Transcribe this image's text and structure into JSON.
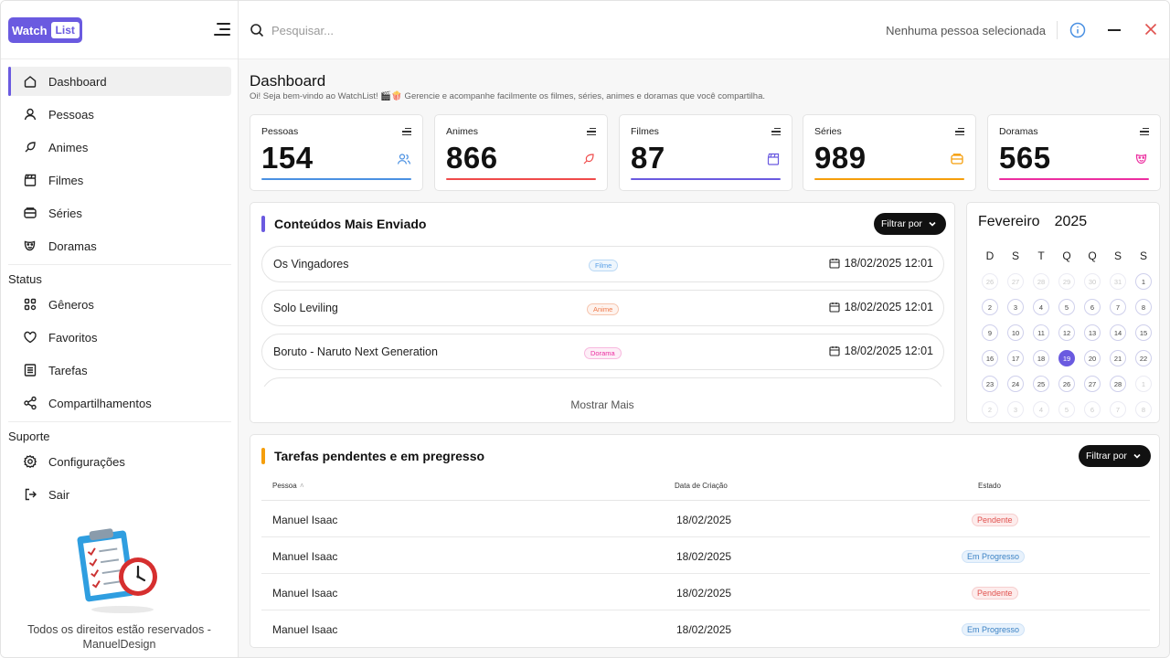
{
  "app": {
    "logo_word": "Watch",
    "logo_badge": "List"
  },
  "sidebar": {
    "items": [
      {
        "label": "Dashboard",
        "icon": "home-icon"
      },
      {
        "label": "Pessoas",
        "icon": "person-icon"
      },
      {
        "label": "Animes",
        "icon": "leaf-icon"
      },
      {
        "label": "Filmes",
        "icon": "clapper-icon"
      },
      {
        "label": "Séries",
        "icon": "tv-icon"
      },
      {
        "label": "Doramas",
        "icon": "mask-icon"
      }
    ],
    "status_title": "Status",
    "status_items": [
      {
        "label": "Gêneros",
        "icon": "grid-icon"
      },
      {
        "label": "Favoritos",
        "icon": "heart-icon"
      },
      {
        "label": "Tarefas",
        "icon": "list-icon"
      },
      {
        "label": "Compartilhamentos",
        "icon": "share-icon"
      }
    ],
    "support_title": "Suporte",
    "support_items": [
      {
        "label": "Configurações",
        "icon": "gear-icon"
      },
      {
        "label": "Sair",
        "icon": "logout-icon"
      }
    ],
    "footer": "Todos os direitos estão reservados  -  ManuelDesign"
  },
  "topbar": {
    "search_placeholder": "Pesquisar...",
    "person_status": "Nenhuma pessoa selecionada"
  },
  "page": {
    "title": "Dashboard",
    "subtitle": "Oi! Seja bem-vindo ao WatchList! 🎬🍿 Gerencie e acompanhe facilmente os filmes, séries, animes e doramas que você compartilha."
  },
  "stats": [
    {
      "label": "Pessoas",
      "value": "154",
      "color": "#4a90e2",
      "icon": "people-icon"
    },
    {
      "label": "Animes",
      "value": "866",
      "color": "#ef4b4b",
      "icon": "leaf-icon"
    },
    {
      "label": "Filmes",
      "value": "87",
      "color": "#6a5ae0",
      "icon": "clapper-icon"
    },
    {
      "label": "Séries",
      "value": "989",
      "color": "#f59e0b",
      "icon": "tv-icon"
    },
    {
      "label": "Doramas",
      "value": "565",
      "color": "#ec2ea0",
      "icon": "mask-icon"
    }
  ],
  "content_panel": {
    "title": "Conteúdos Mais Enviado",
    "accent": "#6a5ae0",
    "filter_label": "Filtrar por",
    "show_more": "Mostrar Mais",
    "rows": [
      {
        "name": "Os Vingadores",
        "tag": "Filme",
        "tag_color": "#5aa0e6",
        "date": "18/02/2025 12:01"
      },
      {
        "name": "Solo Leviling",
        "tag": "Anime",
        "tag_color": "#ef7a4b",
        "date": "18/02/2025 12:01"
      },
      {
        "name": "Boruto - Naruto Next Generation",
        "tag": "Dorama",
        "tag_color": "#ec2ea0",
        "date": "18/02/2025 12:01"
      }
    ]
  },
  "calendar": {
    "month": "Fevereiro",
    "year": "2025",
    "weekdays": [
      "D",
      "S",
      "T",
      "Q",
      "Q",
      "S",
      "S"
    ],
    "selected_day": "19",
    "weeks": [
      [
        [
          "26",
          1
        ],
        [
          "27",
          1
        ],
        [
          "28",
          1
        ],
        [
          "29",
          1
        ],
        [
          "30",
          1
        ],
        [
          "31",
          1
        ],
        [
          "1",
          0
        ]
      ],
      [
        [
          "2",
          0
        ],
        [
          "3",
          0
        ],
        [
          "4",
          0
        ],
        [
          "5",
          0
        ],
        [
          "6",
          0
        ],
        [
          "7",
          0
        ],
        [
          "8",
          0
        ]
      ],
      [
        [
          "9",
          0
        ],
        [
          "10",
          0
        ],
        [
          "11",
          0
        ],
        [
          "12",
          0
        ],
        [
          "13",
          0
        ],
        [
          "14",
          0
        ],
        [
          "15",
          0
        ]
      ],
      [
        [
          "16",
          0
        ],
        [
          "17",
          0
        ],
        [
          "18",
          0
        ],
        [
          "19",
          0
        ],
        [
          "20",
          0
        ],
        [
          "21",
          0
        ],
        [
          "22",
          0
        ]
      ],
      [
        [
          "23",
          0
        ],
        [
          "24",
          0
        ],
        [
          "25",
          0
        ],
        [
          "26",
          0
        ],
        [
          "27",
          0
        ],
        [
          "28",
          0
        ],
        [
          "1",
          1
        ]
      ],
      [
        [
          "2",
          1
        ],
        [
          "3",
          1
        ],
        [
          "4",
          1
        ],
        [
          "5",
          1
        ],
        [
          "6",
          1
        ],
        [
          "7",
          1
        ],
        [
          "8",
          1
        ]
      ]
    ]
  },
  "tasks_panel": {
    "title": "Tarefas pendentes e em pregresso",
    "accent": "#f59e0b",
    "filter_label": "Filtrar por",
    "columns": [
      "Pessoa",
      "Data de Criação",
      "Estado"
    ],
    "rows": [
      {
        "person": "Manuel Isaac",
        "date": "18/02/2025",
        "status": "Pendente",
        "kind": "pend"
      },
      {
        "person": "Manuel Isaac",
        "date": "18/02/2025",
        "status": "Em Progresso",
        "kind": "prog"
      },
      {
        "person": "Manuel Isaac",
        "date": "18/02/2025",
        "status": "Pendente",
        "kind": "pend"
      },
      {
        "person": "Manuel Isaac",
        "date": "18/02/2025",
        "status": "Em Progresso",
        "kind": "prog"
      }
    ]
  }
}
